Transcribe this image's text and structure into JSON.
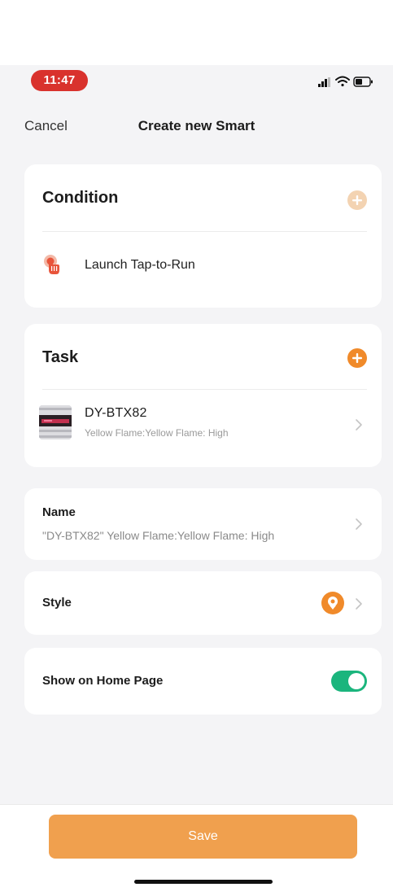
{
  "status_bar": {
    "time": "11:47"
  },
  "nav": {
    "cancel_label": "Cancel",
    "title": "Create new Smart"
  },
  "condition": {
    "header": "Condition",
    "item_label": "Launch Tap-to-Run",
    "item_icon": "tap-hand-icon"
  },
  "task": {
    "header": "Task",
    "device_name": "DY-BTX82",
    "device_action": "Yellow Flame:Yellow Flame: High"
  },
  "name_field": {
    "label": "Name",
    "value": "\"DY-BTX82\" Yellow Flame:Yellow Flame: High"
  },
  "style_field": {
    "label": "Style",
    "icon": "style-icon"
  },
  "home_page": {
    "label": "Show on Home Page",
    "enabled": true
  },
  "footer": {
    "save_label": "Save"
  },
  "colors": {
    "accent": "#f0a04e",
    "add_icon_orange": "#f08a2a",
    "toggle_on": "#1bb57d",
    "time_pill": "#d9322d",
    "condition_icon": "#e8543a"
  }
}
